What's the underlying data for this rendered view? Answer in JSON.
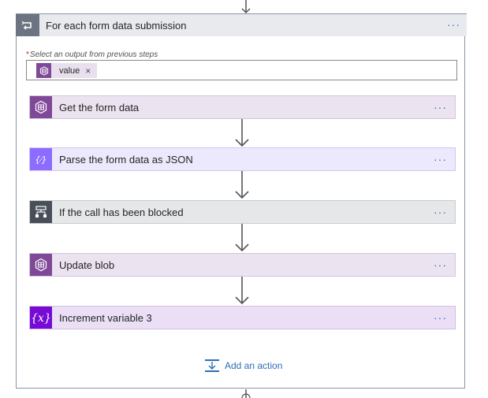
{
  "foreach": {
    "title": "For each form data submission",
    "more_menu": "···",
    "output_label_required": "*",
    "output_label": "Select an output from previous steps",
    "token": {
      "label": "value",
      "remove": "×"
    }
  },
  "actions": [
    {
      "label": "Get the form data",
      "more": "···",
      "icon": "blob-storage-icon",
      "color": "#804998",
      "bg": "#ece3f0"
    },
    {
      "label": "Parse the form data as JSON",
      "more": "···",
      "icon": "data-operations-icon",
      "color": "#8c6cff",
      "bg": "#ede9fd"
    },
    {
      "label": "If the call has been blocked",
      "more": "···",
      "icon": "condition-icon",
      "color": "#484f58",
      "bg": "#e6e7e9"
    },
    {
      "label": "Update blob",
      "more": "···",
      "icon": "blob-storage-icon",
      "color": "#804998",
      "bg": "#ece3f0"
    },
    {
      "label": "Increment variable 3",
      "more": "···",
      "icon": "variable-icon",
      "color": "#770bd6",
      "bg": "#ebdff6"
    }
  ],
  "add_action": {
    "label": "Add an action"
  },
  "colors": {
    "scope_header": "#e8eaee",
    "scope_icon": "#6b7480",
    "link": "#2f6db5",
    "required": "#c4262e"
  }
}
